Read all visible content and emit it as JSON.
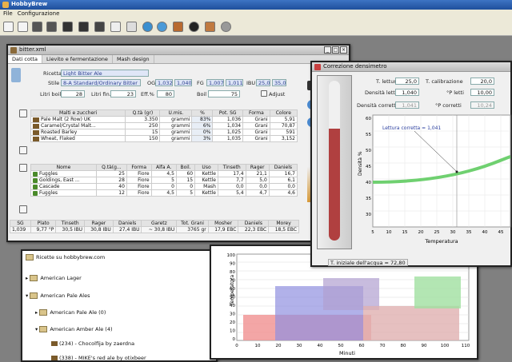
{
  "app": {
    "title": "HobbyBrew"
  },
  "menu": {
    "file": "File",
    "config": "Configurazione"
  },
  "recipe_window": {
    "title": "bitter.xml",
    "tabs": [
      "Dati cotta",
      "Lievito e fermentazione",
      "Mash design"
    ],
    "recipe_label": "Ricetta",
    "recipe_value": "Light Bitter Ale",
    "style_label": "Stile",
    "style_value": "8-A Standard/Ordinary Bitter",
    "og_label": "OG",
    "og_min": "1,032",
    "og_max": "1,040",
    "fg_label": "FG",
    "fg_min": "1,007",
    "fg_max": "1,011",
    "ibu_label": "IBU",
    "ibu_min": "25,0",
    "ibu_max": "35,0",
    "liter_boil_label": "Litri boil.",
    "liter_boil": "28",
    "liters_label": "Litri fin.",
    "liters": "23",
    "eff_label": "Eff.%",
    "eff": "80",
    "boil_label": "Boil",
    "boil": "75",
    "adjust_label": "Adjust",
    "malt_headers": [
      "Malti e zuccheri",
      "Q.tà (gr)",
      "U.mis.",
      "%",
      "Pot. SG",
      "Forma",
      "Colore"
    ],
    "malts": [
      [
        "Pale Malt (2 Row) UK",
        "3.350",
        "grammi",
        "83%",
        "1,036",
        "Grani",
        "5,91"
      ],
      [
        "Caramel/Crystal Malt...",
        "250",
        "grammi",
        "6%",
        "1,034",
        "Grani",
        "70,87"
      ],
      [
        "Roasted Barley",
        "15",
        "grammi",
        "0%",
        "1,025",
        "Grani",
        "591"
      ],
      [
        "Wheat, Flaked",
        "150",
        "grammi",
        "3%",
        "1,035",
        "Grani",
        "3,152"
      ]
    ],
    "hop_headers": [
      "Nome",
      "Q.tà(g...",
      "Forma",
      "Alfa A.",
      "Boil.",
      "Uso",
      "Tinseth",
      "Rager",
      "Daniels"
    ],
    "hops": [
      [
        "Fuggles",
        "25",
        "Fiore",
        "4,5",
        "60",
        "Kettle",
        "17,4",
        "21,1",
        "16,7"
      ],
      [
        "Goldings, East ...",
        "28",
        "Fiore",
        "5",
        "15",
        "Kettle",
        "7,7",
        "5,0",
        "6,1"
      ],
      [
        "Cascade",
        "40",
        "Fiore",
        "0",
        "0",
        "Mash",
        "0,0",
        "0,0",
        "0,0"
      ],
      [
        "Fuggles",
        "12",
        "Fiore",
        "4,5",
        "5",
        "Kettle",
        "5,4",
        "4,7",
        "4,6"
      ]
    ],
    "summary_headers": [
      "SG",
      "Plato",
      "Tinseth",
      "Rager",
      "Daniels",
      "Garetz",
      "Tot. Grani",
      "Mosher",
      "Daniels",
      "Morey"
    ],
    "summary_values": [
      "1,039",
      "9,77 °P",
      "30,5 IBU",
      "30,8 IBU",
      "27,4 IBU",
      "~ 30,8 IBU",
      "3765 gr",
      "17,9 EBC",
      "22,3 EBC",
      "18,5 EBC"
    ]
  },
  "hydro_window": {
    "title": "Correzione densimetro",
    "t_read_label": "T. lettura",
    "t_read": "25,0",
    "t_cal_label": "T. calibrazione",
    "t_cal": "20,0",
    "dens_read_label": "Densità letta",
    "dens_read": "1,040",
    "p_read_label": "°P letti",
    "p_read": "10,00",
    "dens_corr_label": "Densità corretta",
    "dens_corr": "1,041",
    "p_corr_label": "°P corretti",
    "p_corr": "10,24",
    "annotation": "Lettura corretta = 1,041",
    "ylabel": "Densità %",
    "xlabel": "Temperatura",
    "yticks": [
      "60",
      "55",
      "50",
      "45",
      "40",
      "35",
      "30"
    ],
    "xticks": [
      "5",
      "10",
      "15",
      "20",
      "25",
      "30",
      "35",
      "40",
      "45"
    ],
    "water_label": "T. iniziale dell'acqua = 72,80"
  },
  "tree_window": {
    "root": "Ricette su hobbybrew.com",
    "items": [
      "American Lager",
      "American Pale Ales",
      "American Pale Ale (0)",
      "American Amber Ale (4)",
      "(234) - Chocolfija by zaerdna",
      "(338) - MIKE's red ale by otixbeer"
    ]
  },
  "mash_chart": {
    "ylabel": "Temperatura",
    "xlabel": "Minuti",
    "yticks": [
      "100",
      "90",
      "80",
      "70",
      "60",
      "50",
      "40",
      "30",
      "20",
      "10",
      "0"
    ],
    "xticks": [
      "0",
      "10",
      "20",
      "30",
      "40",
      "50",
      "60",
      "70",
      "80",
      "90",
      "100",
      "110"
    ]
  },
  "colors": {
    "accent": "#2b4f9f",
    "curve": "#6fd070",
    "thermo_fill": "#b04040"
  }
}
